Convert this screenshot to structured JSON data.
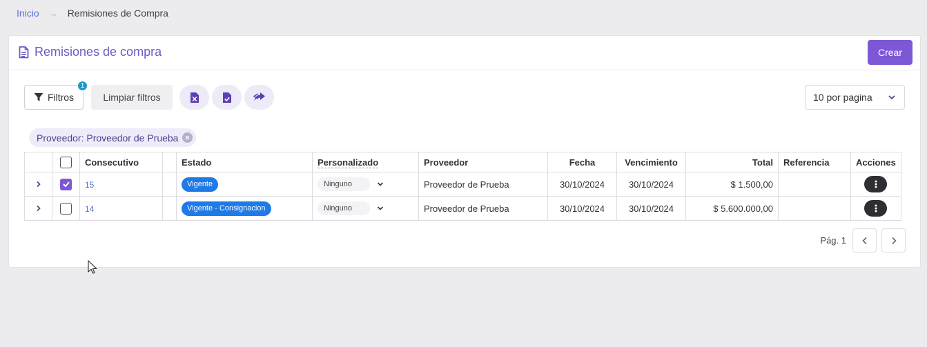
{
  "breadcrumb": {
    "home": "Inicio",
    "separator": "→",
    "current": "Remisiones de Compra"
  },
  "header": {
    "title": "Remisiones de compra",
    "title_icon": "document-icon",
    "create_label": "Crear"
  },
  "toolbar": {
    "filters_label": "Filtros",
    "filters_badge": "1",
    "clear_label": "Limpiar filtros",
    "icon_buttons": [
      "export-excel-icon",
      "document-check-icon",
      "share-icon"
    ],
    "per_page": "10 por pagina"
  },
  "active_filter": {
    "label": "Proveedor: Proveedor de Prueba"
  },
  "table": {
    "columns": [
      "Consecutivo",
      "Estado",
      "Personalizado",
      "Proveedor",
      "Fecha",
      "Vencimiento",
      "Total",
      "Referencia",
      "Acciones"
    ],
    "rows": [
      {
        "checked": true,
        "consecutivo": "15",
        "estado": "Vigente",
        "personalizado": "Ninguno",
        "proveedor": "Proveedor de Prueba",
        "fecha": "30/10/2024",
        "vencimiento": "30/10/2024",
        "total": "$ 1.500,00",
        "referencia": ""
      },
      {
        "checked": false,
        "consecutivo": "14",
        "estado": "Vigente - Consignacion",
        "personalizado": "Ninguno",
        "proveedor": "Proveedor de Prueba",
        "fecha": "30/10/2024",
        "vencimiento": "30/10/2024",
        "total": "$ 5.600.000,00",
        "referencia": ""
      }
    ]
  },
  "pagination": {
    "label": "Pág. 1"
  },
  "colors": {
    "accent": "#7e57d6",
    "status_blue": "#1e7ae6",
    "badge": "#1c9ac9"
  }
}
